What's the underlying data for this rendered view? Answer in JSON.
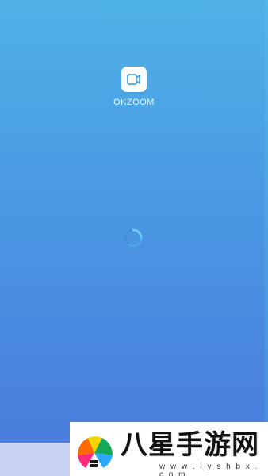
{
  "app": {
    "name": "OKZOOM",
    "icon": "camera-icon"
  },
  "loading": {
    "icon": "loading-spinner-icon",
    "color": "#66c6ff"
  },
  "watermark": {
    "title": "八星手游网",
    "url": "w w w . l y s h b x . c o m",
    "icon": "watermark-logo-icon"
  },
  "colors": {
    "background_top": "#4fb2e6",
    "background_bottom": "#4a79dc",
    "watermark_panel": "#c9d3f2"
  }
}
